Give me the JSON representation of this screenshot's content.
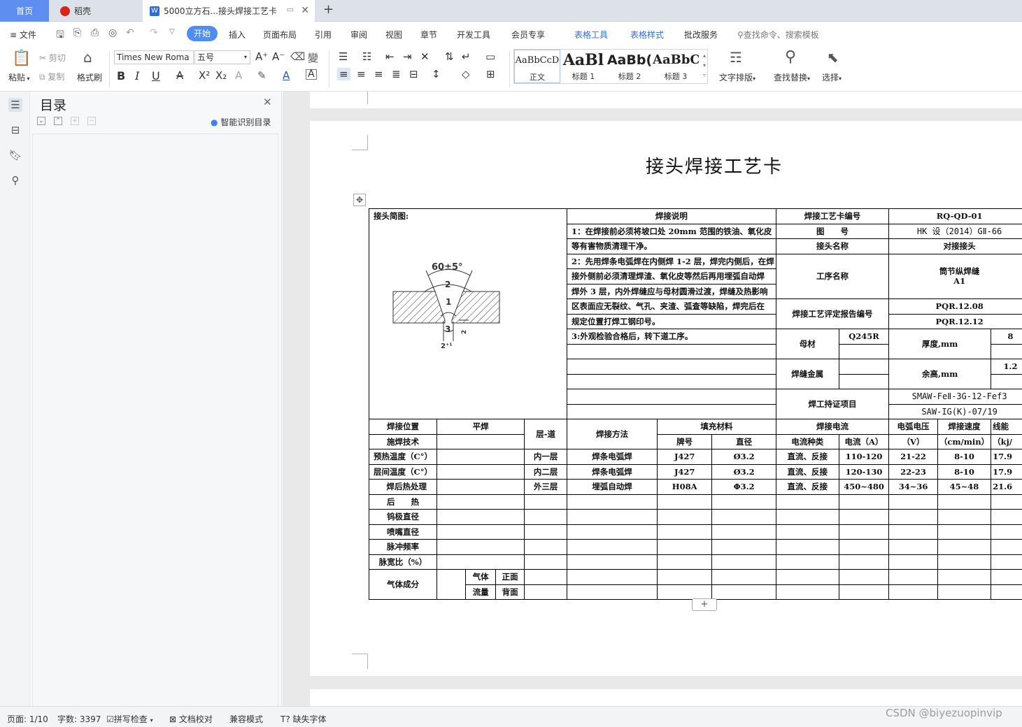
{
  "tabs": {
    "home": "首页",
    "daoke": "稻壳",
    "doc": "5000立方石...接头焊接工艺卡"
  },
  "menu": {
    "file": "文件",
    "items": [
      "开始",
      "插入",
      "页面布局",
      "引用",
      "审阅",
      "视图",
      "章节",
      "开发工具",
      "会员专享",
      "表格工具",
      "表格样式",
      "批改服务"
    ],
    "search": "查找命令、搜索模板"
  },
  "ribbon": {
    "paste": "粘贴",
    "cut": "剪切",
    "copy": "复制",
    "format_painter": "格式刷",
    "font_name": "Times New Roma",
    "font_size": "五号",
    "styles": [
      {
        "preview": "AaBbCcD",
        "name": "正文"
      },
      {
        "preview": "AaBl",
        "name": "标题 1"
      },
      {
        "preview": "AaBb(",
        "name": "标题 2"
      },
      {
        "preview": "AaBbC",
        "name": "标题 3"
      }
    ],
    "text_layout": "文字排版",
    "find_replace": "查找替换",
    "select": "选择"
  },
  "toc": {
    "title": "目录",
    "smart": "智能识别目录"
  },
  "document": {
    "title": "接头焊接工艺卡",
    "table": {
      "sketch_label": "接头简图:",
      "weld_note_header": "焊接说明",
      "notes": [
        "1：在焊接前必须将坡口处 20mm 范围的铁油、氧化皮",
        "等有害物质清理干净。",
        "2：先用焊条电弧焊在内侧焊 1-2 层，焊完内侧后，在焊",
        "接外侧前必须清理焊渣、氧化皮等然后再用埋弧自动焊",
        "焊外 3 层，内外焊缝应与母材圆滑过渡，焊缝及热影响",
        "区表面应无裂纹、气孔、夹渣、弧查等缺陷，焊完后在",
        "规定位置打焊工钢印号。",
        "3:外观检验合格后，转下道工序。"
      ],
      "card_no_label": "焊接工艺卡编号",
      "card_no": "RQ-QD-01",
      "drawing_label": "图　　号",
      "drawing_no": "HK 设（2014）GⅡ-66",
      "joint_name_label": "接头名称",
      "joint_name": "对接接头",
      "process_name_label": "工序名称",
      "process_name": "筒节纵焊缝",
      "process_code": "A1",
      "pqr_label": "焊接工艺评定报告编号",
      "pqr_1": "PQR.12.08",
      "pqr_2": "PQR.12.12",
      "base_metal_label": "母材",
      "base_metal": "Q245R",
      "thickness_label": "厚度,mm",
      "thickness": "8",
      "weld_metal_label": "焊缝金属",
      "reinforcement_label": "余高,mm",
      "reinforcement": "1.2",
      "welder_cert_label": "焊工持证项目",
      "welder_cert_1": "SMAW-FeⅡ-3G-12-Fef3",
      "welder_cert_2": "SAW-IG(K)-07/19",
      "h_position": "焊接位置",
      "h_position_val": "平焊",
      "h_layer": "层-道",
      "h_method": "焊接方法",
      "h_filler": "填充材料",
      "h_current": "焊接电流",
      "h_voltage": "电弧电压",
      "h_speed": "焊接速度",
      "h_heat": "线能",
      "h_technique": "施焊技术",
      "h_grade": "牌号",
      "h_diameter": "直径",
      "h_current_type": "电流种类",
      "h_current_a": "电流（A）",
      "h_voltage_unit": "（V）",
      "h_speed_unit": "（cm/min）",
      "h_heat_unit": "（kj/",
      "preheat": "预热温度（C°）",
      "interpass": "层间温度（C°）",
      "pwht": "焊后热处理",
      "post_heat": "后　　热",
      "tungsten": "钨极直径",
      "nozzle": "喷嘴直径",
      "pulse_freq": "脉冲频率",
      "pulse_ratio": "脉宽比（%）",
      "gas_comp": "气体成分",
      "gas": "气体",
      "flow": "流量",
      "front": "正面",
      "back": "背面",
      "rows": [
        {
          "layer": "内一层",
          "method": "焊条电弧焊",
          "grade": "J427",
          "dia": "Ø3.2",
          "ctype": "直流、反接",
          "amp": "110-120",
          "volt": "21-22",
          "speed": "8-10",
          "heat": "17.9"
        },
        {
          "layer": "内二层",
          "method": "焊条电弧焊",
          "grade": "J427",
          "dia": "Ø3.2",
          "ctype": "直流、反接",
          "amp": "120-130",
          "volt": "22-23",
          "speed": "8-10",
          "heat": "17.9"
        },
        {
          "layer": "外三层",
          "method": "埋弧自动焊",
          "grade": "H08A",
          "dia": "Φ3.2",
          "ctype": "直流、反接",
          "amp": "450~480",
          "volt": "34~36",
          "speed": "45~48",
          "heat": "21.6"
        }
      ],
      "sketch_angle": "60±5°",
      "sketch_gap": "2⁺¹",
      "sketch_root": "2",
      "sketch_bead_1": "1",
      "sketch_bead_2": "2",
      "sketch_bead_3": "3"
    }
  },
  "status": {
    "page": "页面: 1/10",
    "words": "字数: 3397",
    "spell": "拼写检查",
    "proof": "文档校对",
    "compat": "兼容模式",
    "font_missing": "缺失字体"
  },
  "watermark": "CSDN @biyezuopinvip",
  "colors": {
    "accent": "#4f8df5",
    "tab_home": "#5e8ff0",
    "table_tools": "#2e6fd8"
  }
}
